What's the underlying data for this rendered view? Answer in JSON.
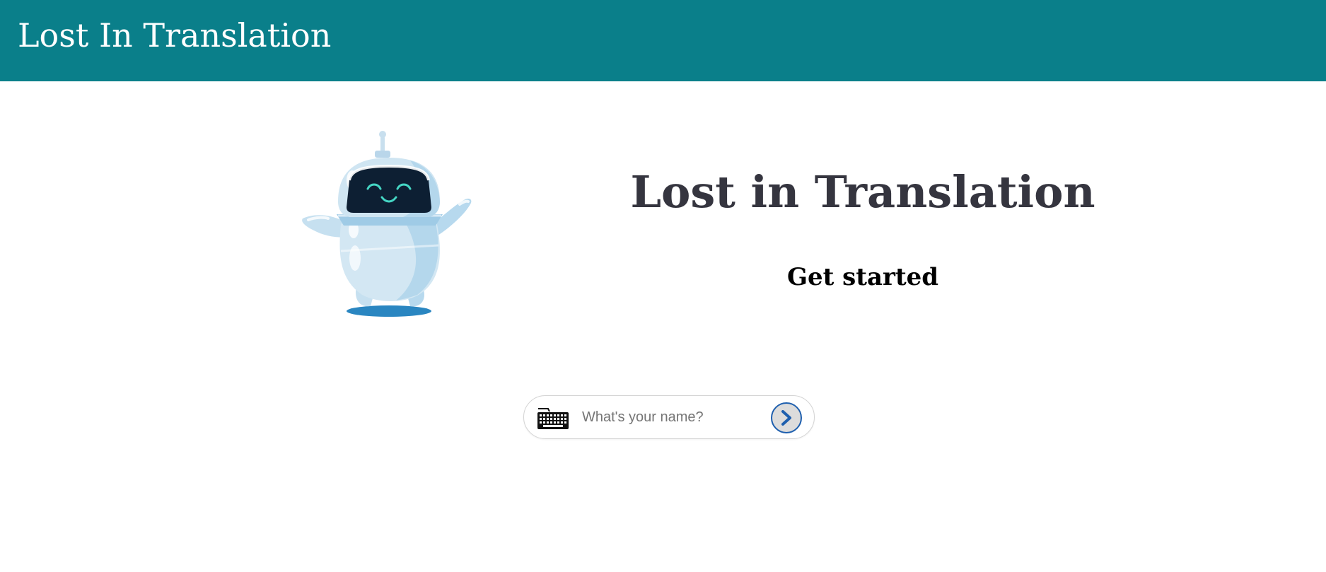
{
  "header": {
    "title": "Lost In Translation"
  },
  "hero": {
    "title": "Lost in Translation",
    "subtitle": "Get started",
    "image_icon": "robot-icon"
  },
  "form": {
    "input_placeholder": "What's your name?",
    "input_value": "",
    "leading_icon": "keyboard-icon",
    "submit_icon": "chevron-right-icon"
  },
  "colors": {
    "header_bg": "#0a7f8a",
    "title_text": "#35353f",
    "accent": "#1e5fae"
  }
}
